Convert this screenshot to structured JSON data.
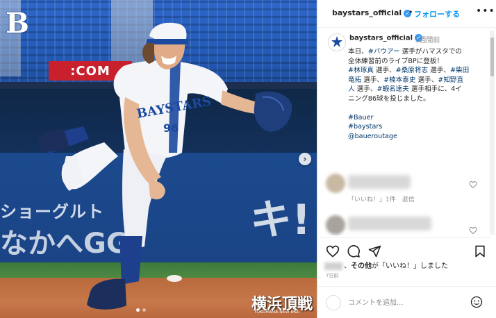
{
  "photo": {
    "team_logo": "B",
    "ad_board": ":COM",
    "wall_text_line1": "ショーグルト",
    "wall_text_line2": "なかへGG!",
    "wall_text_big": "キ!",
    "jersey_number": "96",
    "watermark": "横浜頂戦",
    "watermark_sub": "YOKOHAMA NEW ERA",
    "next_icon": "›"
  },
  "header": {
    "username": "baystars_official",
    "verified_icon": "✓",
    "separator": "•",
    "follow_label": "フォローする",
    "more_icon": "•••"
  },
  "caption": {
    "username": "baystars_official",
    "verified_icon": "✓",
    "time": "1週間前",
    "lines": [
      [
        {
          "t": "本日、"
        },
        {
          "t": "#バウアー",
          "tag": true
        },
        {
          "t": " 選手がハマスタでの"
        }
      ],
      [
        {
          "t": "全体練習前のライブBPに登板！"
        }
      ],
      [
        {
          "t": "#林琢真",
          "tag": true
        },
        {
          "t": " 選手、"
        },
        {
          "t": "#桑原将志",
          "tag": true
        },
        {
          "t": " 選手、"
        },
        {
          "t": "#柴田",
          "tag": true
        }
      ],
      [
        {
          "t": "竜拓",
          "tag": true
        },
        {
          "t": " 選手、"
        },
        {
          "t": "#楠本泰史",
          "tag": true
        },
        {
          "t": " 選手、"
        },
        {
          "t": "#知野直",
          "tag": true
        }
      ],
      [
        {
          "t": "人",
          "tag": true
        },
        {
          "t": " 選手、"
        },
        {
          "t": "#蝦名達夫",
          "tag": true
        },
        {
          "t": " 選手相手に、4イ"
        }
      ],
      [
        {
          "t": "ニング86球を投じました。"
        }
      ],
      [
        {
          "t": ""
        }
      ],
      [
        {
          "t": "#Bauer",
          "tag": true
        }
      ],
      [
        {
          "t": "#baystars",
          "tag": true
        }
      ],
      [
        {
          "t": "@baueroutage",
          "tag": true
        }
      ]
    ]
  },
  "comments": [
    {
      "meta": "「いいね！」1件　返信"
    },
    {
      "meta": ""
    }
  ],
  "likes": {
    "suffix_bold": "その他",
    "suffix": "が「いいね！」しました"
  },
  "posted_ago": "7日前",
  "add_comment": {
    "placeholder": "コメントを追加..."
  },
  "colors": {
    "accent": "#0095f6",
    "tag": "#00376b",
    "verified": "#3897f0"
  }
}
